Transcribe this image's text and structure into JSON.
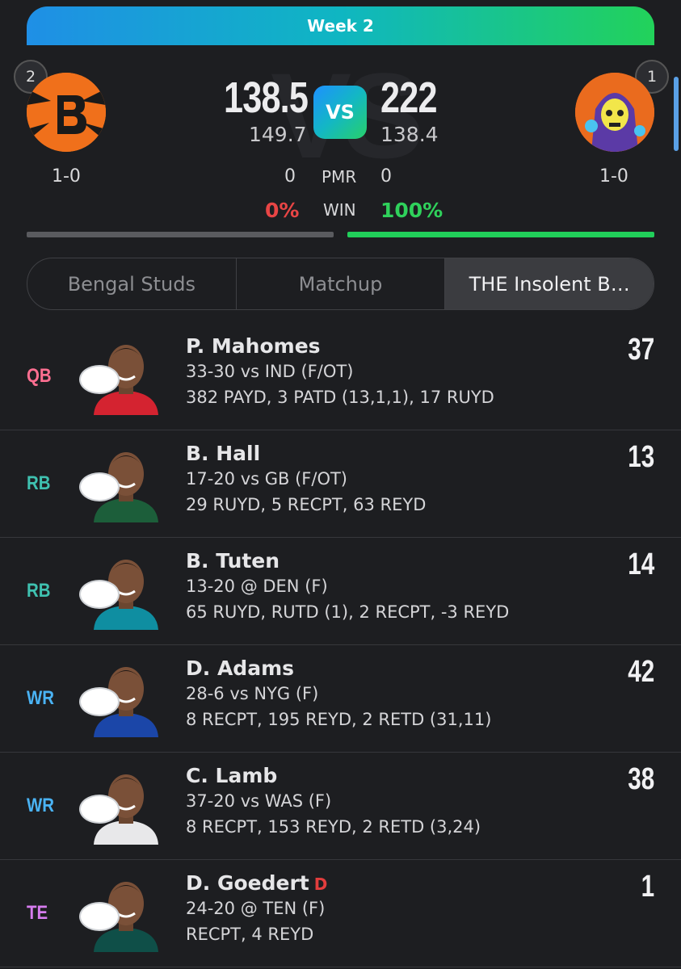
{
  "week": "Week 2",
  "vs_label": "VS",
  "vs_badge": "VS",
  "left_team": {
    "rank": "2",
    "record": "1-0",
    "score": "138.5",
    "projected": "149.7",
    "pmr": "0",
    "win_pct": "0%",
    "win_color": "#e84545"
  },
  "right_team": {
    "rank": "1",
    "record": "1-0",
    "score": "222",
    "projected": "138.4",
    "pmr": "0",
    "win_pct": "100%",
    "win_color": "#2fd15b"
  },
  "labels": {
    "pmr": "PMR",
    "win": "WIN"
  },
  "progress": {
    "left_fill": 0.0,
    "right_fill": 1.0
  },
  "tabs": [
    {
      "label": "Bengal Studs",
      "active": false
    },
    {
      "label": "Matchup",
      "active": false
    },
    {
      "label": "THE Insolent B…",
      "active": true
    }
  ],
  "position_colors": {
    "QB": "#ff6f91",
    "RB": "#3fc1b0",
    "WR": "#4ab3f4",
    "TE": "#d77cf0"
  },
  "players": [
    {
      "pos": "QB",
      "name": "P. Mahomes",
      "status": "",
      "game": "33-30 vs IND (F/OT)",
      "stats": "382 PAYD, 3 PATD (13,1,1), 17 RUYD",
      "points": "37",
      "team_icon": "chiefs-logo-icon",
      "jersey": "#d42330"
    },
    {
      "pos": "RB",
      "name": "B. Hall",
      "status": "",
      "game": "17-20 vs GB (F/OT)",
      "stats": "29 RUYD, 5 RECPT, 63 REYD",
      "points": "13",
      "team_icon": "jets-logo-icon",
      "jersey": "#1c5e3a"
    },
    {
      "pos": "RB",
      "name": "B. Tuten",
      "status": "",
      "game": "13-20 @ DEN (F)",
      "stats": "65 RUYD, RUTD (1), 2 RECPT, -3 REYD",
      "points": "14",
      "team_icon": "jaguars-logo-icon",
      "jersey": "#0f8ea1"
    },
    {
      "pos": "WR",
      "name": "D. Adams",
      "status": "",
      "game": "28-6 vs NYG (F)",
      "stats": "8 RECPT, 195 REYD, 2 RETD (31,11)",
      "points": "42",
      "team_icon": "rams-logo-icon",
      "jersey": "#1b46a8"
    },
    {
      "pos": "WR",
      "name": "C. Lamb",
      "status": "",
      "game": "37-20 vs WAS (F)",
      "stats": "8 RECPT, 153 REYD, 2 RETD (3,24)",
      "points": "38",
      "team_icon": "cowboys-logo-icon",
      "jersey": "#e8e8ea"
    },
    {
      "pos": "TE",
      "name": "D. Goedert",
      "status": "D",
      "game": "24-20 @ TEN (F)",
      "stats": "RECPT, 4 REYD",
      "points": "1",
      "team_icon": "eagles-logo-icon",
      "jersey": "#0f4f48"
    }
  ]
}
